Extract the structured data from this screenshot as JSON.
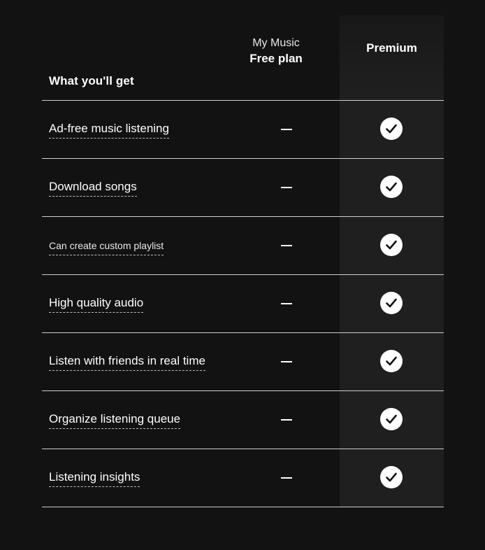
{
  "header": {
    "section_label": "What you'll get",
    "free_plan_sub": "My Music",
    "free_plan_name": "Free plan",
    "premium_plan_name": "Premium"
  },
  "features": [
    {
      "label": "Ad-free music listening",
      "free": "—",
      "premium": "check-icon"
    },
    {
      "label": "Download songs",
      "free": "—",
      "premium": "check-icon"
    },
    {
      "label": "Can create custom playlist",
      "free": "—",
      "premium": "check-icon"
    },
    {
      "label": "High quality audio",
      "free": "—",
      "premium": "check-icon"
    },
    {
      "label": "Listen with friends in real time",
      "free": "—",
      "premium": "check-icon"
    },
    {
      "label": "Organize listening queue",
      "free": "—",
      "premium": "check-icon"
    },
    {
      "label": "Listening insights",
      "free": "—",
      "premium": "check-icon"
    }
  ],
  "colors": {
    "background": "#121212",
    "premium_column": "#1f1f1f",
    "text": "#ffffff",
    "divider": "#cfcfcf"
  }
}
